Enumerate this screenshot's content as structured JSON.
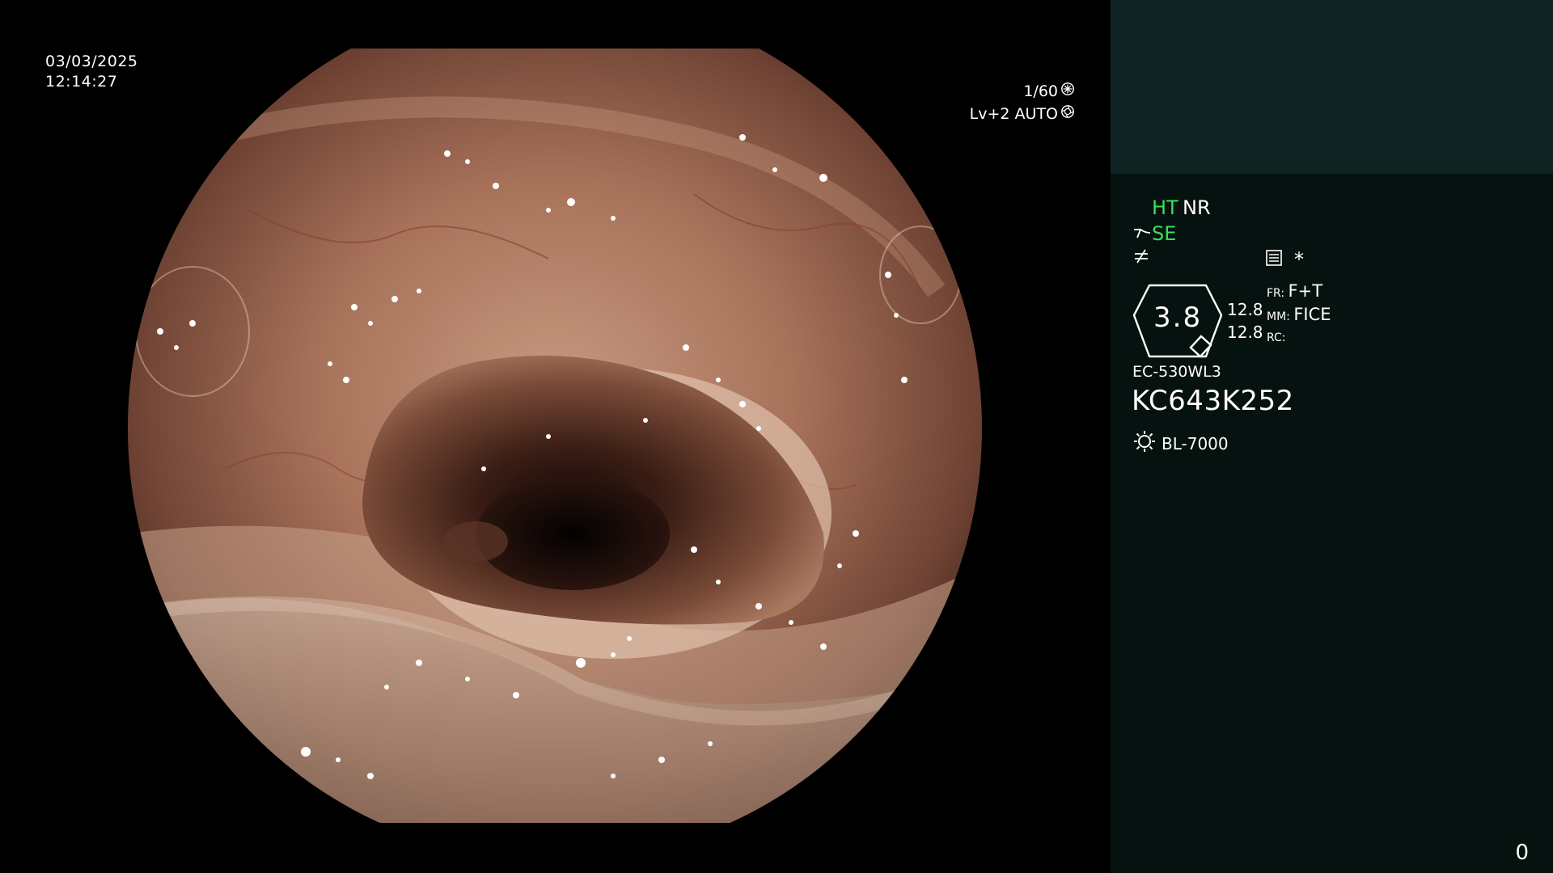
{
  "overlay": {
    "date": "03/03/2025",
    "time": "12:14:27",
    "shutter": "1/60",
    "iris": "Lv+2 AUTO",
    "shutter_icon": "aperture-icon",
    "iris_icon": "iris-icon"
  },
  "panel": {
    "modes": {
      "ht": "HT",
      "nr": "NR",
      "se": "SE",
      "se_icon": "scope-tip-icon",
      "struct_icon": "not-equal-icon",
      "memo_icon": "memo-icon",
      "star": "*"
    },
    "zoom": {
      "value": "3.8",
      "val1": "12.8",
      "val2": "12.8",
      "fr_label": "FR:",
      "fr_value": "F+T",
      "mm_label": "MM:",
      "mm_value": "FICE",
      "rc_label": "RC:"
    },
    "scope_model": "EC-530WL3",
    "serial": "KC643K252",
    "light_source": "BL-7000",
    "light_icon": "sun-icon",
    "counter": "0"
  },
  "colors": {
    "panel_top": "#0f2422",
    "panel_body": "#061210",
    "green_text": "#39e05a"
  }
}
